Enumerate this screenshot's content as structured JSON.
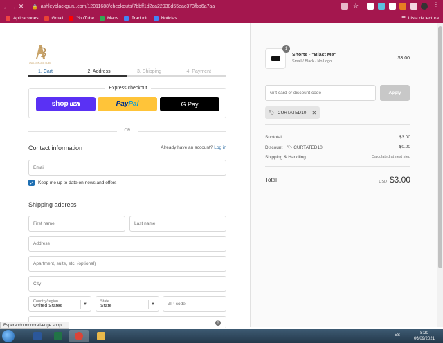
{
  "browser": {
    "url": "ashleyblackguru.com/12011688/checkouts/7bbff1d2ca22938d55eac373fbb6a7aa",
    "bookmarks": [
      {
        "label": "Aplicaciones",
        "color": "#e44"
      },
      {
        "label": "Gmail",
        "color": "#ea4335"
      },
      {
        "label": "YouTube",
        "color": "#ff0000"
      },
      {
        "label": "Maps",
        "color": "#34a853"
      },
      {
        "label": "Traducir",
        "color": "#4285f4"
      },
      {
        "label": "Noticias",
        "color": "#4285f4"
      }
    ],
    "reading_list": "Lista de lectura"
  },
  "logo": {
    "text": "ASHLEY BLACK GURU"
  },
  "steps": [
    "1. Cart",
    "2. Address",
    "3. Shipping",
    "4. Payment"
  ],
  "express": {
    "label": "Express checkout",
    "shoppay": "shop",
    "shoppay_badge": "Pay",
    "paypal_a": "Pay",
    "paypal_b": "Pal",
    "gpay": "G Pay"
  },
  "or_text": "OR",
  "contact": {
    "title": "Contact information",
    "hint": "Already have an account?",
    "login": "Log in",
    "email_placeholder": "Email",
    "newsletter": "Keep me up to date on news and offers"
  },
  "shipping": {
    "title": "Shipping address",
    "first_name": "First name",
    "last_name": "Last name",
    "address": "Address",
    "apartment": "Apartment, suite, etc. (optional)",
    "city": "City",
    "country_label": "Country/region",
    "country_value": "United States",
    "state_label": "State",
    "state_value": "State",
    "zip": "ZIP code"
  },
  "order": {
    "qty": "1",
    "product_name": "Shorts - \"Blast Me\"",
    "product_variant": "Small / Black / No Logo",
    "product_price": "$3.00",
    "gift_placeholder": "Gift card or discount code",
    "apply": "Apply",
    "discount_tag": "CURTATED10",
    "subtotal_label": "Subtotal",
    "subtotal_value": "$3.00",
    "discount_label": "Discount",
    "discount_code": "CURTATED10",
    "discount_value": "$0.00",
    "shipping_label": "Shipping & Handling",
    "shipping_value": "Calculated at next step",
    "total_label": "Total",
    "currency": "USD",
    "total_value": "$3.00"
  },
  "status_text": "Esperando monorail-edge.shopi...",
  "taskbar": {
    "lang": "ES",
    "time": "8:20",
    "date": "06/09/2021"
  }
}
